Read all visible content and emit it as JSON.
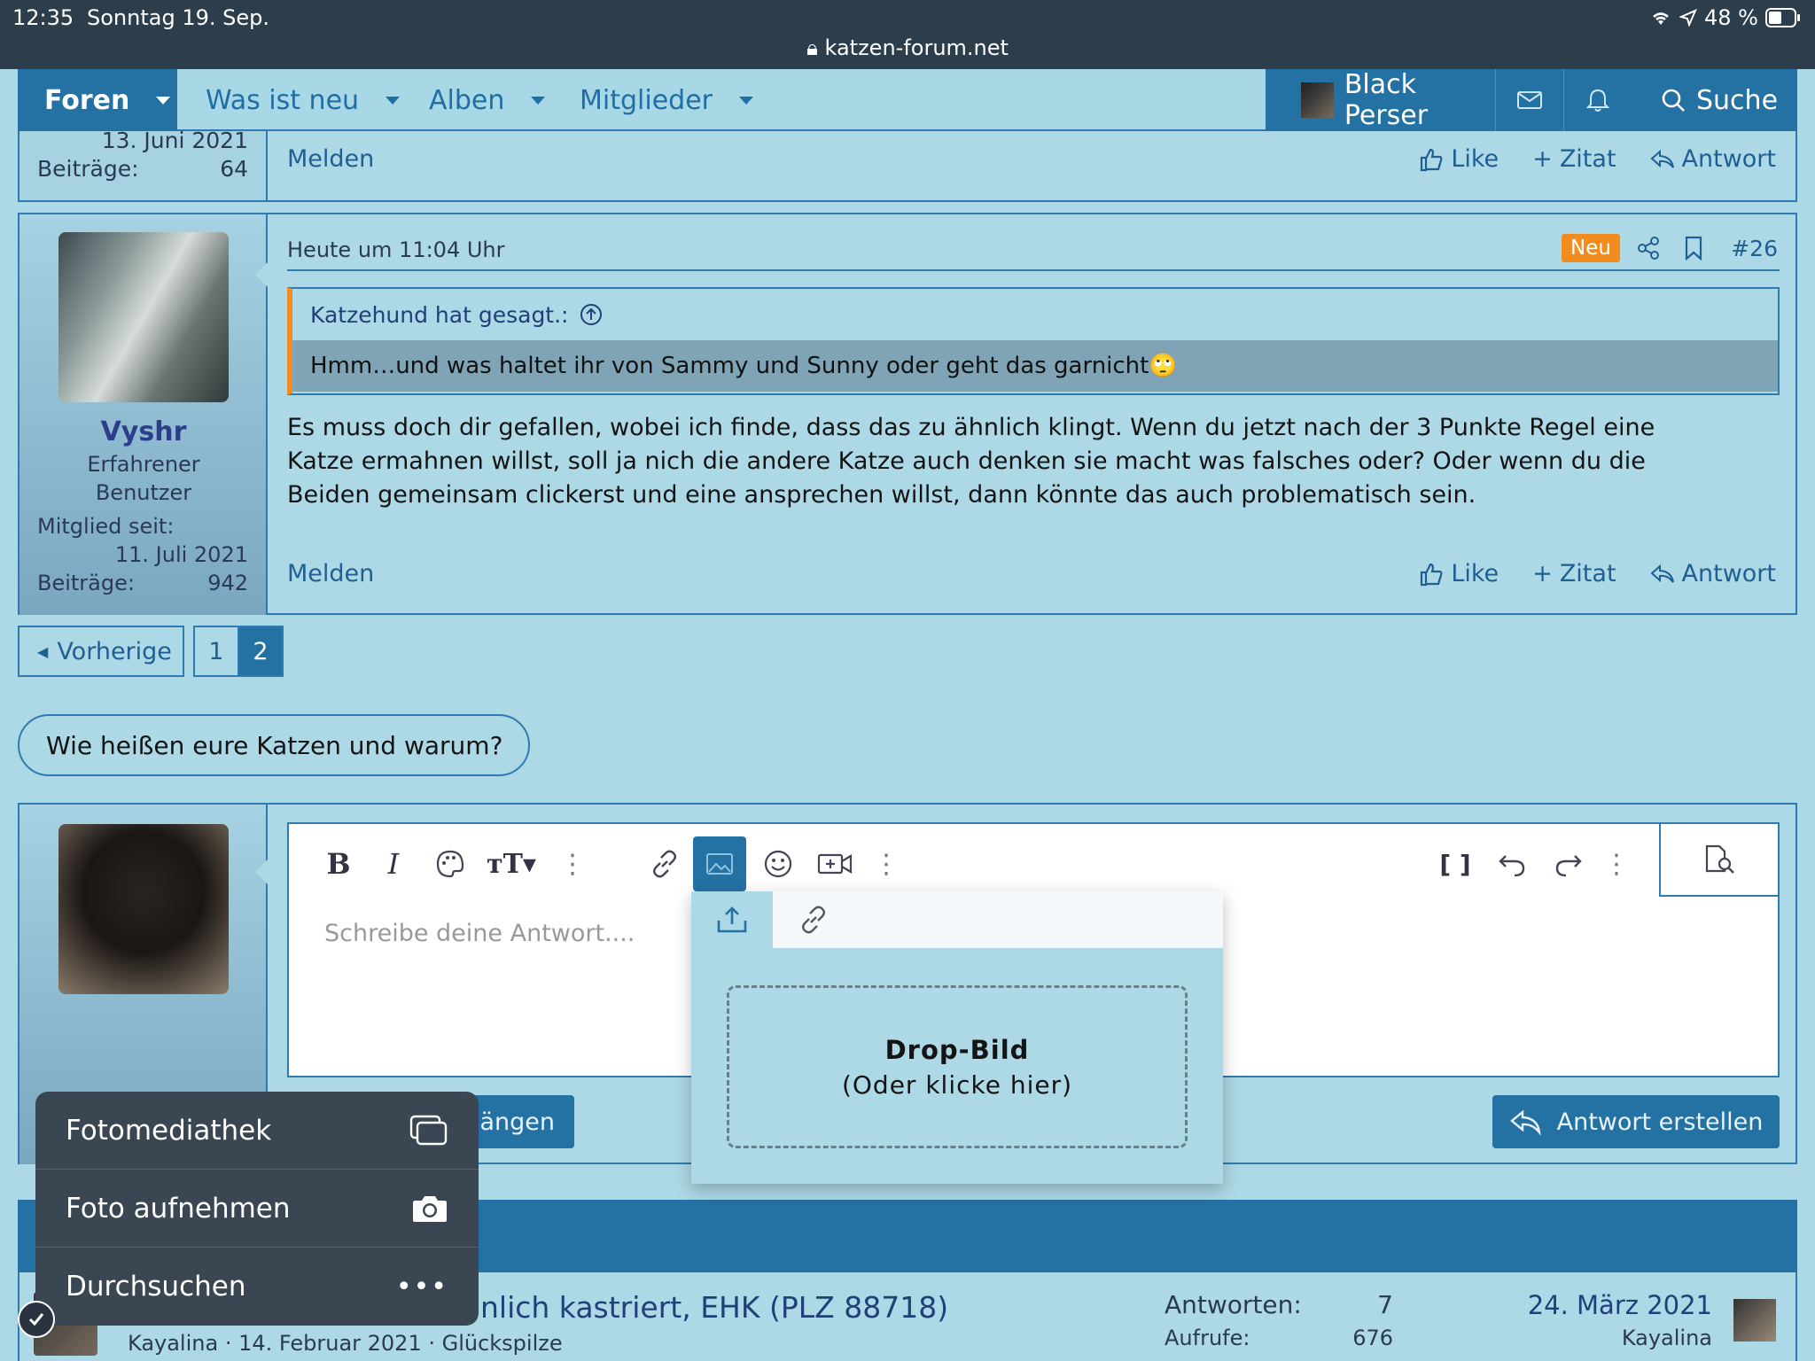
{
  "statusbar": {
    "time": "12:35",
    "date": "Sonntag 19. Sep.",
    "url": "katzen-forum.net",
    "battery": "48 %"
  },
  "nav": {
    "foren": "Foren",
    "was_ist_neu": "Was ist neu",
    "alben": "Alben",
    "mitglieder": "Mitglieder",
    "user": "Black Perser",
    "search": "Suche"
  },
  "prev_post": {
    "joined_date": "13. Juni 2021",
    "posts_label": "Beiträge:",
    "posts_count": "64",
    "report": "Melden",
    "like": "Like",
    "quote": "Zitat",
    "reply": "Antwort"
  },
  "post": {
    "username": "Vyshr",
    "role_line1": "Erfahrener",
    "role_line2": "Benutzer",
    "member_since_label": "Mitglied seit:",
    "member_since": "11. Juli 2021",
    "posts_label": "Beiträge:",
    "posts_count": "942",
    "time": "Heute um 11:04 Uhr",
    "badge_new": "Neu",
    "post_number": "#26",
    "quote_author": "Katzehund hat gesagt.:",
    "quote_text": "Hmm…und was haltet ihr von Sammy und Sunny oder geht das garnicht🙄",
    "body_line1": "Es muss doch dir gefallen, wobei ich finde, dass das zu ähnlich klingt. Wenn du jetzt nach der 3 Punkte Regel eine",
    "body_line2": "Katze ermahnen willst, soll ja nich die andere Katze auch denken sie macht was falsches oder? Oder wenn du die",
    "body_line3": "Beiden gemeinsam clickerst und eine ansprechen willst, dann könnte das auch problematisch sein.",
    "report": "Melden",
    "like": "Like",
    "quote": "Zitat",
    "reply": "Antwort"
  },
  "pagination": {
    "prev": "Vorherige",
    "pages": [
      "1",
      "2"
    ],
    "current": "2"
  },
  "thread_title": "Wie heißen eure Katzen und warum?",
  "editor": {
    "placeholder": "Schreibe deine Antwort....",
    "attach_partial": "hängen",
    "submit": "Antwort erstellen"
  },
  "image_dropdown": {
    "drop_title": "Drop-Bild",
    "drop_sub": "(Oder klicke hier)"
  },
  "ios_menu": {
    "items": [
      "Fotomediathek",
      "Foto aufnehmen",
      "Durchsuchen"
    ]
  },
  "similar": {
    "title_partial": "nlich kastriert, EHK (PLZ 88718)",
    "meta": "Kayalina · 14. Februar 2021 · Glückspilze",
    "replies_label": "Antworten:",
    "replies": "7",
    "views_label": "Aufrufe:",
    "views": "676",
    "last_date": "24. März 2021",
    "last_user": "Kayalina"
  },
  "colors": {
    "background": "#add8e6",
    "accent": "#2472a4",
    "badge": "#f28c1e",
    "statusbar": "#2c3e4c"
  }
}
